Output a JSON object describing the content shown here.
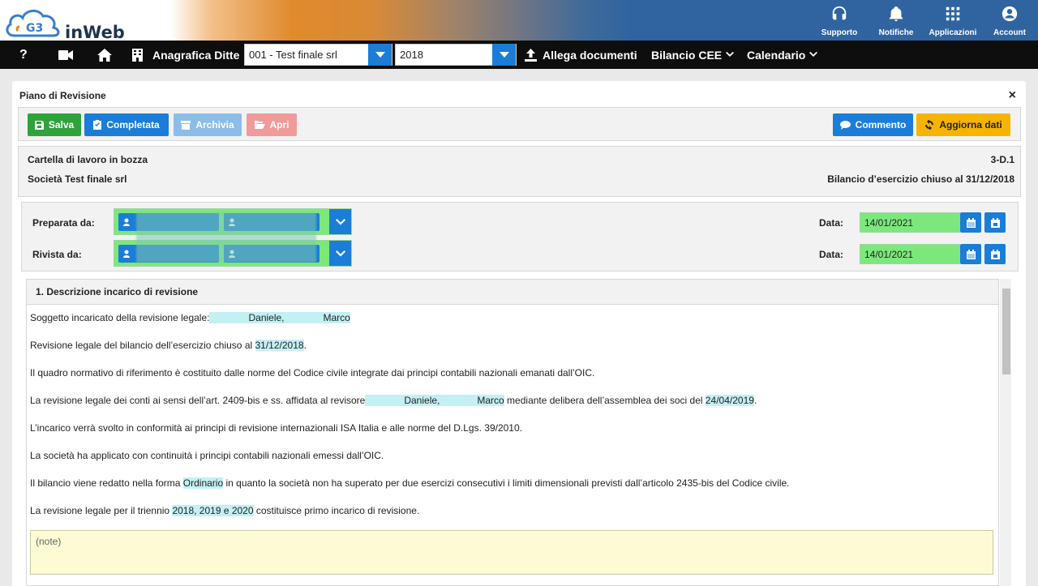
{
  "header": {
    "app_name": "inWeb",
    "logo_initials": "G3",
    "actions": [
      {
        "label": "Supporto",
        "icon": "headset-icon"
      },
      {
        "label": "Notifiche",
        "icon": "bell-icon"
      },
      {
        "label": "Applicazioni",
        "icon": "apps-grid-icon"
      },
      {
        "label": "Account",
        "icon": "user-circle-icon"
      }
    ]
  },
  "nav": {
    "help": "?",
    "anagrafica": "Anagrafica Ditte",
    "company_select": "001 - Test finale srl",
    "year_select": "2018",
    "allega": "Allega documenti",
    "bilancio": "Bilancio CEE",
    "calendario": "Calendario"
  },
  "modal": {
    "title": "Piano di Revisione",
    "close": "×",
    "buttons": {
      "salva": "Salva",
      "completata": "Completata",
      "archivia": "Archivia",
      "apri": "Apri",
      "commento": "Commento",
      "aggiorna": "Aggiorna dati"
    },
    "colors": {
      "salva": "#2fa23b",
      "completata": "#1a7dd7",
      "archivia": "#8cbde9",
      "apri": "#f09a9a",
      "commento": "#1a7dd7",
      "aggiorna": "#f6b400"
    },
    "info": {
      "status": "Cartella di lavoro in bozza",
      "code": "3-D.1",
      "company": "Società Test finale srl",
      "period": "Bilancio d’esercizio chiuso al 31/12/2018"
    },
    "people": {
      "preparata_label": "Preparata da:",
      "rivista_label": "Rivista da:",
      "data_label": "Data:",
      "preparata_date": "14/01/2021",
      "rivista_date": "14/01/2021"
    },
    "section": {
      "title": "1. Descrizione incarico di revisione",
      "p1_a": "Soggetto incaricato della revisione legale:",
      "p1_b": "Daniele,",
      "p1_c": "Marco",
      "p2_a": "Revisione legale del bilancio dell’esercizio chiuso al ",
      "p2_b": "31/12/2018",
      "p2_c": ".",
      "p3": "Il quadro normativo di riferimento è costituito dalle norme del Codice civile integrate dai principi contabili nazionali emanati dall’OIC.",
      "p4_a": "La revisione legale dei conti ai sensi dell’art. 2409-bis e ss. affidata al revisore",
      "p4_b": "Daniele,",
      "p4_c": "Marco",
      "p4_d": " mediante delibera dell’assemblea dei soci del ",
      "p4_e": "24/04/2019",
      "p4_f": ".",
      "p5": "L’incarico verrà svolto in conformità ai principi di revisione internazionali ISA Italia e alle norme del D.Lgs. 39/2010.",
      "p6": "La società ha applicato con continuità i principi contabili nazionali emessi dall’OIC.",
      "p7_a": "Il bilancio viene redatto nella forma ",
      "p7_b": "Ordinario",
      "p7_c": " in quanto la società non ha superato per due esercizi consecutivi i limiti dimensionali previsti dall’articolo 2435-bis del Codice civile.",
      "p8_a": "La revisione legale per il triennio ",
      "p8_b": "2018, 2019 e 2020",
      "p8_c": " costituisce primo incarico di revisione.",
      "notes_placeholder": "(note)"
    }
  }
}
